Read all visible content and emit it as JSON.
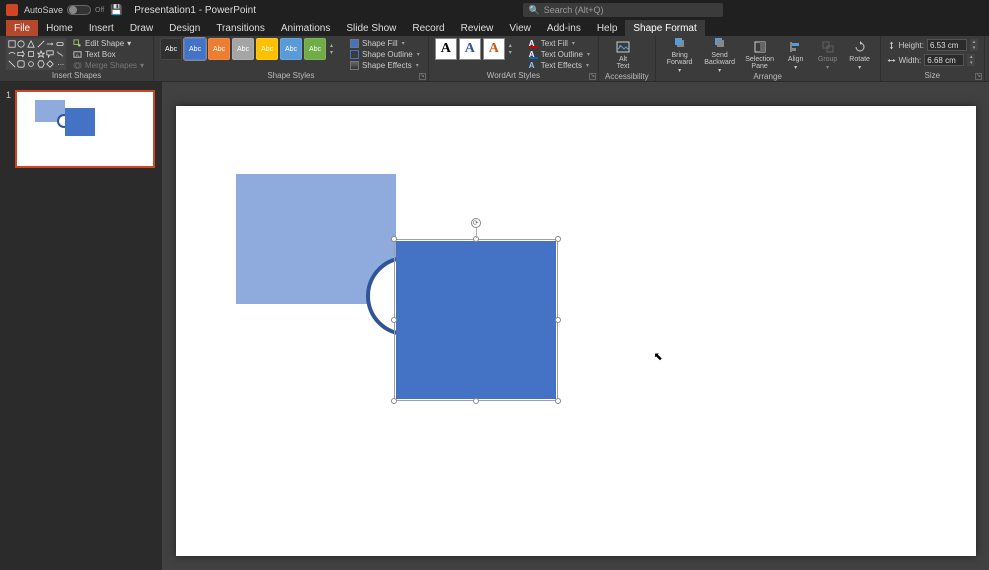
{
  "title_bar": {
    "autosave_label": "AutoSave",
    "autosave_state": "Off",
    "doc_title": "Presentation1 - PowerPoint",
    "search_placeholder": "Search (Alt+Q)"
  },
  "tabs": {
    "file": "File",
    "home": "Home",
    "insert": "Insert",
    "draw": "Draw",
    "design": "Design",
    "transitions": "Transitions",
    "animations": "Animations",
    "slideshow": "Slide Show",
    "record": "Record",
    "review": "Review",
    "view": "View",
    "addins": "Add-ins",
    "help": "Help",
    "shape_format": "Shape Format"
  },
  "ribbon": {
    "insert_shapes": {
      "edit_shape": "Edit Shape",
      "text_box": "Text Box",
      "merge_shapes": "Merge Shapes",
      "group_label": "Insert Shapes"
    },
    "shape_styles": {
      "swatch_text": "Abc",
      "colors": [
        "#303030",
        "#4472c4",
        "#ed7d31",
        "#a5a5a5",
        "#ffc000",
        "#5b9bd5",
        "#70ad47"
      ],
      "shape_fill": "Shape Fill",
      "shape_outline": "Shape Outline",
      "shape_effects": "Shape Effects",
      "group_label": "Shape Styles"
    },
    "wordart": {
      "letter": "A",
      "colors": [
        "#000000",
        "#305496",
        "#c65911"
      ],
      "text_fill": "Text Fill",
      "text_outline": "Text Outline",
      "text_effects": "Text Effects",
      "group_label": "WordArt Styles"
    },
    "accessibility": {
      "alt_text": "Alt\nText",
      "group_label": "Accessibility"
    },
    "arrange": {
      "bring_forward": "Bring\nForward",
      "send_backward": "Send\nBackward",
      "selection_pane": "Selection\nPane",
      "align": "Align",
      "group": "Group",
      "rotate": "Rotate",
      "group_label": "Arrange"
    },
    "size": {
      "height_label": "Height:",
      "height_value": "6.53 cm",
      "width_label": "Width:",
      "width_value": "6.68 cm",
      "group_label": "Size"
    }
  },
  "thumbnails": {
    "slide1_num": "1"
  },
  "canvas": {
    "selected_shape": "Rectangle 2"
  }
}
